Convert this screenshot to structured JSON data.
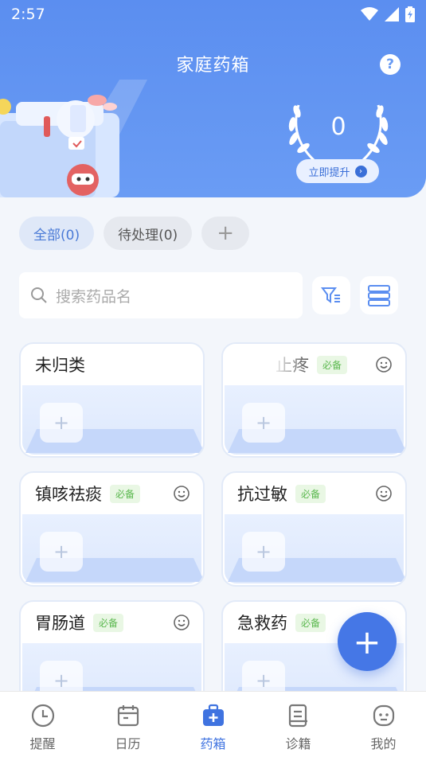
{
  "status_bar": {
    "time": "2:57"
  },
  "header": {
    "title": "家庭药箱",
    "help_icon": "question-circle-icon",
    "score": "0",
    "boost_label": "立即提升"
  },
  "filter_chips": [
    {
      "label": "全部(0)",
      "active": true
    },
    {
      "label": "待处理(0)",
      "active": false
    }
  ],
  "add_chip_label": "+",
  "search": {
    "placeholder": "搜索药品名"
  },
  "cards": [
    {
      "title": "未归类",
      "badge": ""
    },
    {
      "title": "止疼",
      "badge": "必备"
    },
    {
      "title": "镇咳祛痰",
      "badge": "必备"
    },
    {
      "title": "抗过敏",
      "badge": "必备"
    },
    {
      "title": "胃肠道",
      "badge": "必备"
    },
    {
      "title": "急救药",
      "badge": "必备"
    }
  ],
  "card_add_label": "+",
  "fab_label": "+",
  "tabs": [
    {
      "label": "提醒",
      "icon": "clock-icon"
    },
    {
      "label": "日历",
      "icon": "calendar-icon"
    },
    {
      "label": "药箱",
      "icon": "medicine-box-icon",
      "active": true
    },
    {
      "label": "诊籍",
      "icon": "record-icon"
    },
    {
      "label": "我的",
      "icon": "profile-icon"
    }
  ],
  "colors": {
    "primary": "#5b8ef0",
    "accent": "#4577e6",
    "badge_green": "#5bb84f"
  }
}
